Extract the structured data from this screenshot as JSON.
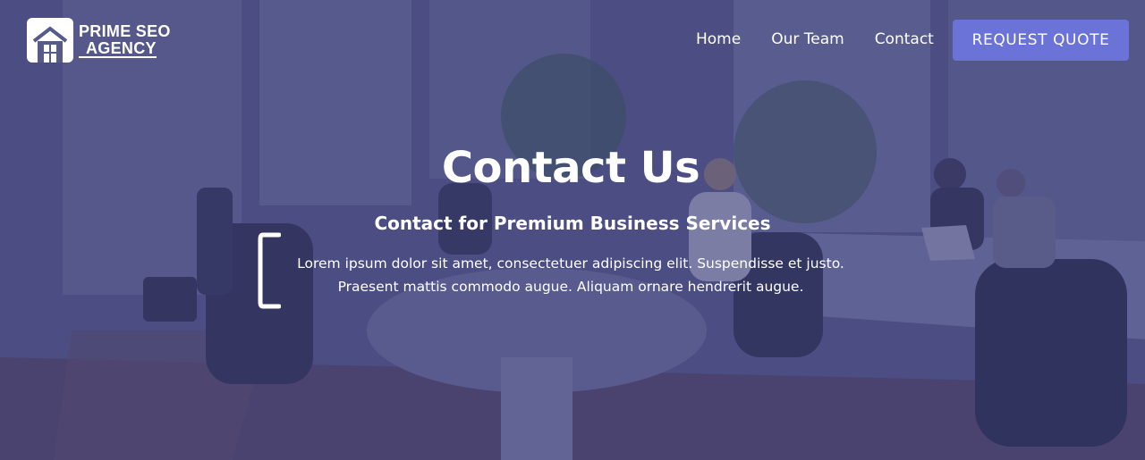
{
  "brand": {
    "line1": "PRIME SEO",
    "line2": "AGENCY"
  },
  "nav": {
    "links": [
      "Home",
      "Our Team",
      "Contact"
    ],
    "cta_label": "REQUEST QUOTE"
  },
  "hero": {
    "title": "Contact Us",
    "subtitle": "Contact for Premium Business Services",
    "description": "Lorem ipsum dolor sit amet, consectetuer adipiscing elit. Suspendisse et justo. Praesent mattis commodo augue. Aliquam ornare hendrerit augue."
  },
  "colors": {
    "overlay": "#3e4273",
    "accent_button": "#6b73d9",
    "text": "#ffffff"
  }
}
